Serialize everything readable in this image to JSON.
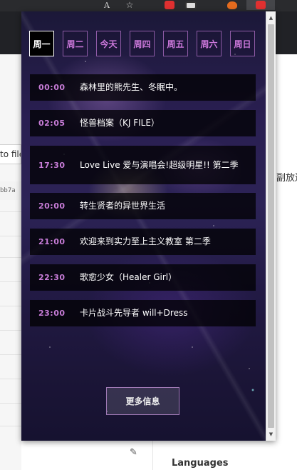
{
  "background": {
    "toolbar_aa": "A",
    "input_text": "to file",
    "hash_text": "bb7a",
    "right_text": "副放送",
    "languages_label": "Languages",
    "edit_icon": "pencil-icon"
  },
  "popup": {
    "tabs": [
      {
        "label": "周一",
        "active": true
      },
      {
        "label": "周二",
        "active": false
      },
      {
        "label": "今天",
        "active": false
      },
      {
        "label": "周四",
        "active": false
      },
      {
        "label": "周五",
        "active": false
      },
      {
        "label": "周六",
        "active": false
      },
      {
        "label": "周日",
        "active": false
      }
    ],
    "schedule": [
      {
        "time": "00:00",
        "title": "森林里的熊先生、冬眠中。"
      },
      {
        "time": "02:05",
        "title": "怪兽档案（KJ FILE）"
      },
      {
        "time": "17:30",
        "title": "Love Live 爱与演唱会!超级明星!! 第二季"
      },
      {
        "time": "20:00",
        "title": "转生贤者的异世界生活"
      },
      {
        "time": "21:00",
        "title": "欢迎来到实力至上主义教室 第二季"
      },
      {
        "time": "22:30",
        "title": "歌愈少女（Healer Girl）"
      },
      {
        "time": "23:00",
        "title": "卡片战斗先导者 will+Dress"
      }
    ],
    "more_button": "更多信息"
  },
  "colors": {
    "accent": "#c77cd7",
    "tab_border": "#8e5ba6",
    "active_tab_bg": "#000000"
  }
}
